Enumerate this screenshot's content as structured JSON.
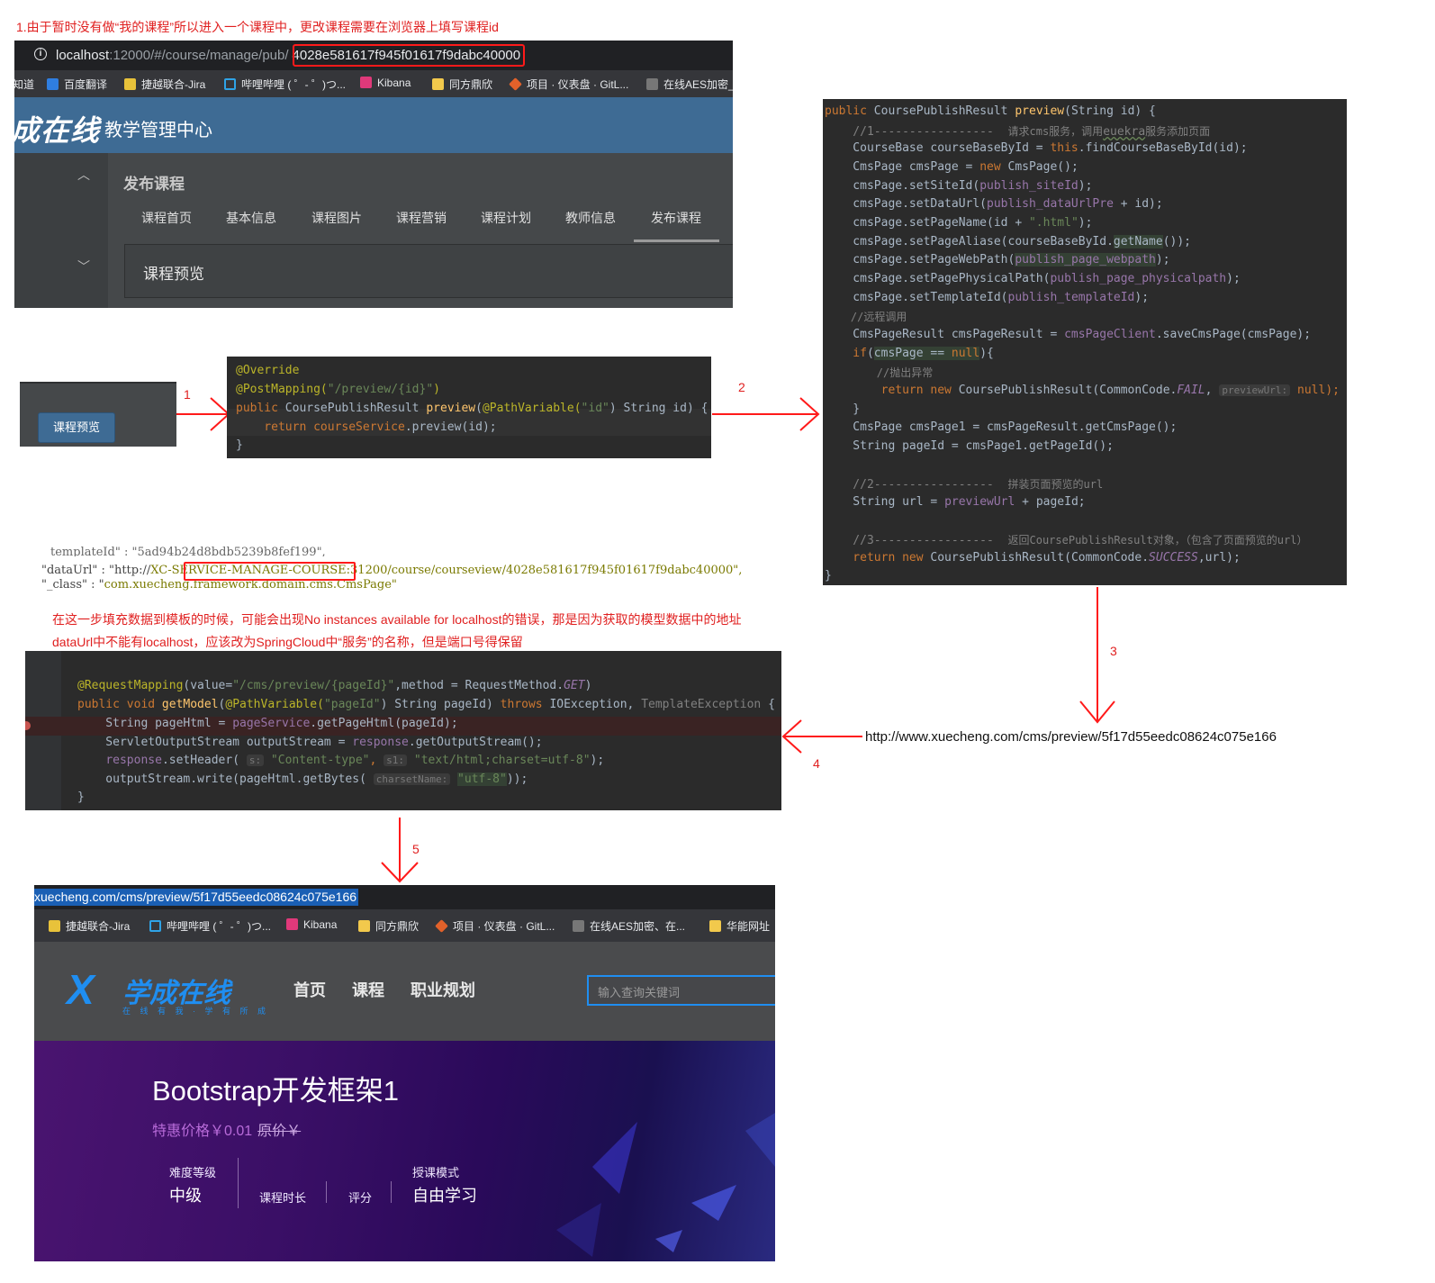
{
  "notes": {
    "top": "1.由于暂时没有做“我的课程”所以进入一个课程中，更改课程需要在浏览器上填写课程id",
    "middle_line1": "在这一步填充数据到模板的时候，可能会出现No instances available for localhost的错误，那是因为获取的模型数据中的地址",
    "middle_line2": "dataUrl中不能有localhost，应该改为SpringCloud中“服务”的名称，但是端口号得保留"
  },
  "step_labels": {
    "s1": "1",
    "s2": "2",
    "s3": "3",
    "s4": "4",
    "s5": "5"
  },
  "browser_a": {
    "url_host": "localhost",
    "url_path": ":12000/#/course/manage/pub/",
    "url_id": "4028e581617f945f01617f9dabc40000",
    "bookmarks": [
      "知道",
      "百度翻译",
      "捷越联合-Jira",
      "哔哩哔哩 ( ゜- ゜)つ...",
      "Kibana",
      "同方鼎欣",
      "项目 · 仪表盘 · GitL...",
      "在线AES加密_"
    ],
    "logo": "成在线",
    "header_title": "教学管理中心",
    "section_title": "发布课程",
    "tabs": [
      "课程首页",
      "基本信息",
      "课程图片",
      "课程营销",
      "课程计划",
      "教师信息",
      "发布课程"
    ],
    "preview_title": "课程预览"
  },
  "button_panel": {
    "preview_button": "课程预览"
  },
  "code1": {
    "l1": "@Override",
    "l2a": "@PostMapping(",
    "l2b": "\"/preview/{id}\"",
    "l2c": ")",
    "l3a": "public ",
    "l3b": "CoursePublishResult ",
    "l3c": "preview",
    "l3d": "(",
    "l3e": "@PathVariable",
    "l3f": "(",
    "l3g": "\"id\"",
    "l3h": ") String id) {",
    "l4a": "    return ",
    "l4b": "courseService",
    "l4c": ".",
    "l4d": "preview",
    "l4e": "(id);",
    "l5": "}"
  },
  "code2": {
    "l1a": "public ",
    "l1b": "CoursePublishResult ",
    "l1c": "preview",
    "l1d": "(String id) {",
    "l2a": "    //1-----------------  ",
    "l2b": "请求cms服务，调用",
    "l2c": "euekra",
    "l2d": "服务添加页面",
    "l3a": "    CourseBase courseBaseById = ",
    "l3b": "this",
    "l3c": ".findCourseBaseById(id);",
    "l4a": "    CmsPage cmsPage = ",
    "l4b": "new ",
    "l4c": "CmsPage();",
    "l5a": "    cmsPage.setSiteId(",
    "l5b": "publish_siteId",
    "l5c": ");",
    "l6a": "    cmsPage.setDataUrl(",
    "l6b": "publish_dataUrlPre",
    "l6c": " + id);",
    "l7a": "    cmsPage.setPageName(id + ",
    "l7b": "\".html\"",
    "l7c": ");",
    "l8a": "    cmsPage.setPageAliase(courseBaseById.",
    "l8b": "getName",
    "l8c": "());",
    "l9a": "    cmsPage.setPageWebPath(",
    "l9b": "publish_page_webpath",
    "l9c": ");",
    "l10a": "    cmsPage.setPagePhysicalPath(",
    "l10b": "publish_page_physicalpath",
    "l10c": ");",
    "l11a": "    cmsPage.setTemplateId(",
    "l11b": "publish_templateId",
    "l11c": ");",
    "l12": "    //远程调用",
    "l13a": "    CmsPageResult cmsPageResult = ",
    "l13b": "cmsPageClient",
    "l13c": ".saveCmsPage(cmsPage);",
    "l14a": "    if",
    "l14b": "(",
    "l14c": "cmsPage == ",
    "l14d": "null",
    "l14e": "){",
    "l15": "        //抛出异常",
    "l16a": "        return new ",
    "l16b": "CoursePublishResult(CommonCode.",
    "l16c": "FAIL",
    "l16d": ", ",
    "l16e": "previewUrl:",
    "l16f": " null);",
    "l17": "    }",
    "l18": "    CmsPage cmsPage1 = cmsPageResult.getCmsPage();",
    "l19": "    String pageId = cmsPage1.getPageId();",
    "l20a": "    //2-----------------  ",
    "l20b": "拼装页面预览的url",
    "l21a": "    String url = ",
    "l21b": "previewUrl",
    "l21c": " + pageId;",
    "l22a": "    //3-----------------  ",
    "l22b": "返回CoursePublishResult对象，（包含了页面预览的url）",
    "l23a": "    return new ",
    "l23b": "CoursePublishResult(CommonCode.",
    "l23c": "SUCCESS",
    "l23d": ",url);",
    "l24": "}"
  },
  "json_snip": {
    "l0": "templateId\" : \"5ad94b24d8bdb5239b8fef199\",",
    "l1a": "\"dataUrl\" : \"http://",
    "l1b": "XC-SERVICE-MANAGE-COURSE",
    "l1c": ":31200/course/courseview/4028e581617f945f01617f9dabc40000\",",
    "l2a": "\"_class\" : \"",
    "l2b": "com.xuecheng.framework.domain.cms.CmsPage\""
  },
  "cms_url": "http://www.xuecheng.com/cms/preview/5f17d55eedc08624c075e166",
  "code3": {
    "l1a": "@RequestMapping",
    "l1b": "(value=",
    "l1c": "\"/cms/preview/{pageId}\"",
    "l1d": ",method ",
    "l1e": "= ",
    "l1f": "RequestMethod.",
    "l1g": "GET",
    "l1h": ")",
    "l2a": "public void ",
    "l2b": "getModel",
    "l2c": "(",
    "l2d": "@PathVariable",
    "l2e": "(",
    "l2f": "\"pageId\"",
    "l2g": ") String pageId) ",
    "l2h": "throws ",
    "l2i": "IOException, ",
    "l2j": "TemplateException",
    "l2k": " {",
    "l3a": "    String pageHtml = ",
    "l3b": "pageService",
    "l3c": ".getPageHtml(pageId);",
    "l4a": "    ServletOutputStream outputStream = ",
    "l4b": "response",
    "l4c": ".getOutputStream();",
    "l5a": "    ",
    "l5b": "response",
    "l5c": ".setHeader( ",
    "l5d": "s:",
    "l5e": " \"Content-type\"",
    "l5f": ", ",
    "l5g": "s1:",
    "l5h": " \"text/html;charset=utf-8\"",
    "l5i": ");",
    "l6a": "    outputStream.write(pageHtml.getBytes( ",
    "l6b": "charsetName:",
    "l6c": " ",
    "l6d": "\"utf-8\"",
    "l6e": "));",
    "l7": "}"
  },
  "browser_b": {
    "url_selected": "xuecheng.com/cms/preview/5f17d55eedc08624c075e166",
    "bookmarks": [
      "捷越联合-Jira",
      "哔哩哔哩 ( ゜- ゜)つ...",
      "Kibana",
      "同方鼎欣",
      "项目 · 仪表盘 · GitL...",
      "在线AES加密、在...",
      "华能网址"
    ],
    "logo_name": "学成在线",
    "logo_slogan": "在 线 有 我 · 学 有 所 成",
    "nav": [
      "首页",
      "课程",
      "职业规划"
    ],
    "search_placeholder": "输入查询关键词",
    "course_title": "Bootstrap开发框架1",
    "price_label": "特惠价格￥0.01",
    "orig_price": "原价￥",
    "meta": {
      "difficulty_label": "难度等级",
      "difficulty_value": "中级",
      "duration_label": "课程时长",
      "rating_label": "评分",
      "mode_label": "授课模式",
      "mode_value": "自由学习"
    }
  },
  "colors": {
    "annotation_red": "#e02020",
    "admin_blue": "#3e6b94",
    "site_blue": "#1f8ef1"
  }
}
